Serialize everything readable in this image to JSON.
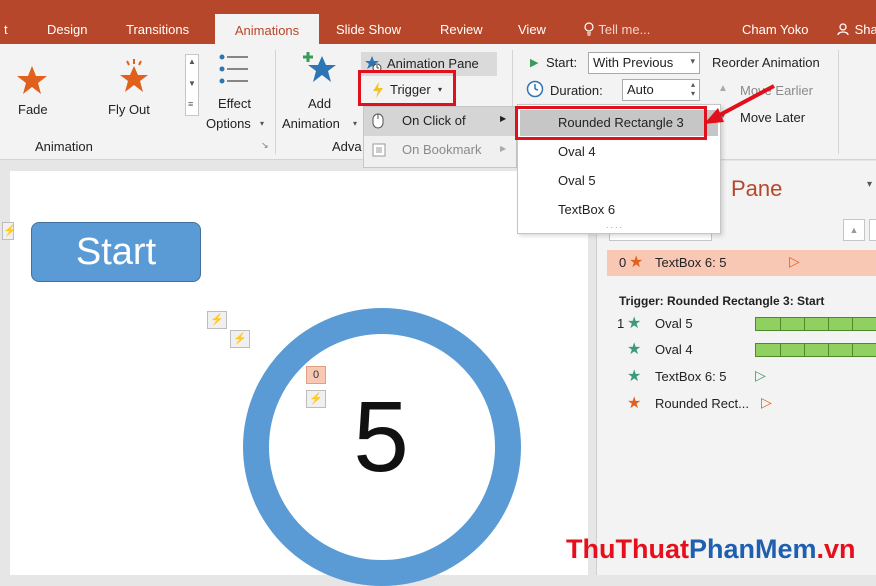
{
  "tabs": [
    {
      "label": "t"
    },
    {
      "label": "Design"
    },
    {
      "label": "Transitions"
    },
    {
      "label": "Animations"
    },
    {
      "label": "Slide Show"
    },
    {
      "label": "Review"
    },
    {
      "label": "View"
    }
  ],
  "tell_me": "Tell me...",
  "user_name": "Cham Yoko",
  "share_label": "Sha",
  "ribbon": {
    "effects": {
      "fade": "Fade",
      "fly_out": "Fly Out"
    },
    "effect_options": {
      "line1": "Effect",
      "line2": "Options"
    },
    "group_animation": "Animation",
    "add_animation": {
      "line1": "Add",
      "line2": "Animation"
    },
    "group_advanced": "Adva",
    "animation_pane": "Animation Pane",
    "trigger": "Trigger",
    "on_click_of": "On Click of",
    "on_bookmark": "On Bookmark",
    "start_label": "Start:",
    "start_value": "With Previous",
    "duration_label": "Duration:",
    "duration_value": "Auto",
    "reorder": "Reorder Animation",
    "move_earlier": "Move Earlier",
    "move_later": "Move Later"
  },
  "submenu": {
    "items": [
      "Rounded Rectangle 3",
      "Oval 4",
      "Oval 5",
      "TextBox 6"
    ]
  },
  "slide": {
    "start_text": "Start",
    "number": "5",
    "tag_zero": "0"
  },
  "pane": {
    "title": "Pane",
    "row0_num": "0",
    "row0_label": "TextBox 6: 5",
    "trigger_header": "Trigger: Rounded Rectangle 3: Start",
    "items": [
      {
        "num": "1",
        "label": "Oval 5"
      },
      {
        "num": "",
        "label": "Oval 4"
      },
      {
        "num": "",
        "label": "TextBox 6: 5"
      },
      {
        "num": "",
        "label": "Rounded Rect..."
      }
    ]
  },
  "watermark": {
    "part1": "ThuThuat",
    "part2": "PhanMem",
    "part3": ".vn"
  },
  "colors": {
    "accent": "#b7472a",
    "highlight_red": "#e0101c",
    "shape_blue": "#5b9bd5",
    "exit_star": "#e0601c",
    "emphasis_star": "#3a9a7a"
  }
}
